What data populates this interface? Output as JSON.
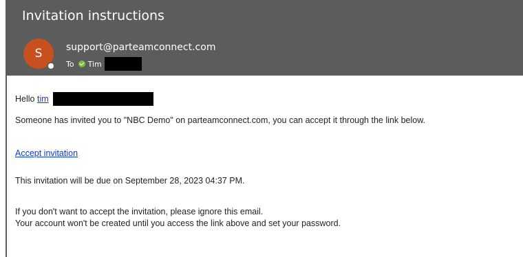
{
  "email": {
    "subject": "Invitation instructions",
    "avatar_initial": "S",
    "sender": "support@parteamconnect.com",
    "to_label": "To",
    "recipient_name": "Tim"
  },
  "body": {
    "greeting": "Hello",
    "greeting_name": "tim",
    "intro": "Someone has invited you to \"NBC Demo\" on parteamconnect.com, you can accept it through the link below.",
    "accept_link": "Accept invitation",
    "due": "This invitation will be due on September 28, 2023 04:37 PM.",
    "ignore": "If you don't want to accept the invitation, please ignore this email.",
    "account": "Your account won't be created until you access the link above and set your password."
  },
  "colors": {
    "header_bg": "#5c5c5c",
    "avatar_bg": "#c8501e",
    "link": "#0b3ad6",
    "presence": "#7cbb3a"
  }
}
